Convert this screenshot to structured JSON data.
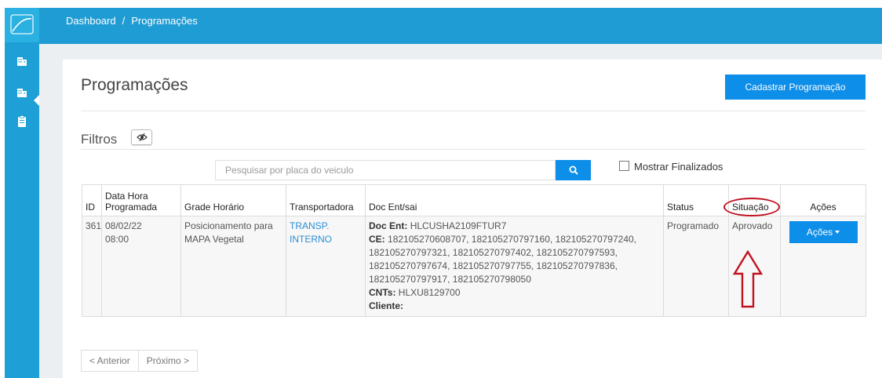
{
  "breadcrumb": {
    "home": "Dashboard",
    "separator": "/",
    "current": "Programações"
  },
  "page": {
    "title": "Programações",
    "create_button": "Cadastrar Programação"
  },
  "filters": {
    "label": "Filtros",
    "search_placeholder": "Pesquisar por placa do veiculo",
    "show_finished_label": "Mostrar Finalizados",
    "show_finished_checked": false
  },
  "table": {
    "headers": {
      "id": "ID",
      "datetime_line1": "Data Hora",
      "datetime_line2": "Programada",
      "grade": "Grade Horário",
      "carrier": "Transportadora",
      "doc": "Doc Ent/sai",
      "status": "Status",
      "situation": "Situação",
      "actions": "Ações"
    },
    "rows": [
      {
        "id": "361",
        "date": "08/02/22",
        "time": "08:00",
        "grade": "Posicionamento para MAPA Vegetal",
        "carrier_line1": "TRANSP.",
        "carrier_line2": "INTERNO",
        "doc_ent_label": "Doc Ent:",
        "doc_ent": "HLCUSHA2109FTUR7",
        "ce_label": "CE:",
        "ce_line1": "182105270608707, 182105270797160, 182105270797240,",
        "ce_line2": "182105270797321, 182105270797402, 182105270797593,",
        "ce_line3": "182105270797674, 182105270797755, 182105270797836,",
        "ce_line4": "182105270797917, 182105270798050",
        "cnts_label": "CNTs:",
        "cnts": "HLXU8129700",
        "cliente_label": "Cliente:",
        "cliente": "",
        "status": "Programado",
        "situation": "Aprovado",
        "actions_button": "Ações"
      }
    ]
  },
  "pagination": {
    "prev": "< Anterior",
    "next": "Próximo >"
  },
  "colors": {
    "primary": "#0d8ee8",
    "topbar": "#1f9cd3",
    "sidebar": "#1e9fd6",
    "annotation": "#c1121f"
  },
  "icons": {
    "sidebar": [
      "logo-icon",
      "building-icon",
      "building-icon",
      "clipboard-icon"
    ],
    "search": "search-icon",
    "toggle": "eye-toggle-icon",
    "annotation": [
      "red-oval-highlight",
      "red-up-arrow"
    ]
  }
}
